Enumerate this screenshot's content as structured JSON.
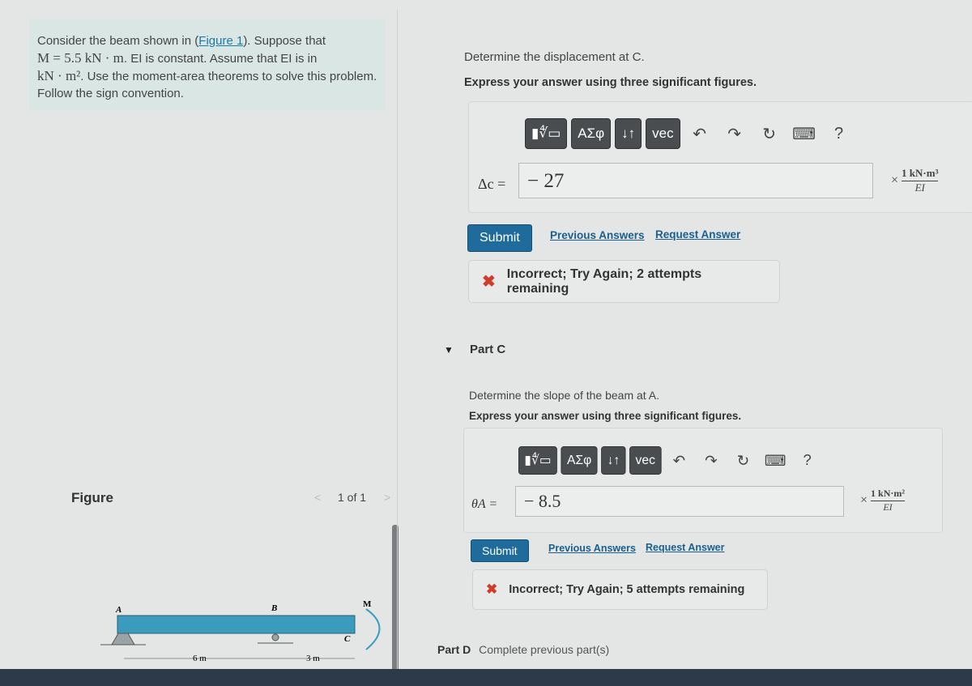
{
  "problem": {
    "text_before_link": "Consider the beam shown in (",
    "link": "Figure 1",
    "text_after_link": "). Suppose that",
    "line2_math": "M = 5.5 kN · m",
    "line2_text": ". EI is constant. Assume that EI is in",
    "line3_math": "kN · m²",
    "line3_text": ". Use the moment-area theorems to solve this problem. Follow the sign convention."
  },
  "figure": {
    "label": "Figure",
    "pager": "1 of 1",
    "prev": "<",
    "next": ">",
    "labels": {
      "a": "A",
      "b": "B",
      "c": "C",
      "m": "M",
      "d1": "6 m",
      "d2": "3 m"
    },
    "beam_color": "#3a9bbd"
  },
  "toolbar": {
    "templates": "▮∜▭",
    "greek": "ΑΣφ",
    "arrows": "↓↑",
    "vec": "vec",
    "undo": "↶",
    "redo": "↷",
    "reset": "↻",
    "keyboard": "⌨",
    "help": "?"
  },
  "part_b": {
    "question": "Determine the displacement at C.",
    "instruction": "Express your answer using three significant figures.",
    "label": "Δc =",
    "value": "− 27",
    "unit_num": "1 kN·m³",
    "unit_den": "EI",
    "times": "×",
    "submit": "Submit",
    "previous_answers": "Previous Answers",
    "request_answer": "Request Answer",
    "feedback": "Incorrect; Try Again; 2 attempts remaining"
  },
  "part_c": {
    "title": "Part C",
    "question": "Determine the slope of the beam at A.",
    "instruction": "Express your answer using three significant figures.",
    "label": "θA =",
    "value": "− 8.5",
    "unit_num": "1 kN·m²",
    "unit_den": "EI",
    "times": "×",
    "submit": "Submit",
    "previous_answers": "Previous Answers",
    "request_answer": "Request Answer",
    "feedback": "Incorrect; Try Again; 5 attempts remaining"
  },
  "part_d": {
    "title": "Part D",
    "status": "Complete previous part(s)"
  },
  "colors": {
    "accent": "#1e6b9c",
    "error": "#d03b2a"
  }
}
